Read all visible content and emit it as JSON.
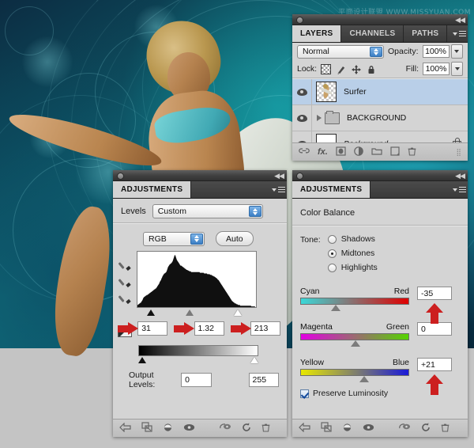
{
  "app": {
    "watermark": "平面设计联盟   WWW.MISSYUAN.COM"
  },
  "layers_panel": {
    "grip_collapse_icon": "collapse-left-icon",
    "tabs": [
      {
        "label": "LAYERS",
        "active": true
      },
      {
        "label": "CHANNELS",
        "active": false
      },
      {
        "label": "PATHS",
        "active": false
      }
    ],
    "menu_icon": "panel-menu-icon",
    "blend_mode": "Normal",
    "opacity_label": "Opacity:",
    "opacity_value": "100%",
    "lock_label": "Lock:",
    "lock_icons": [
      "lock-transparent-icon",
      "lock-image-icon",
      "lock-position-icon",
      "lock-all-icon"
    ],
    "fill_label": "Fill:",
    "fill_value": "100%",
    "layers": [
      {
        "name": "Surfer",
        "visible": true,
        "selected": true,
        "type": "image",
        "style": "normal"
      },
      {
        "name": "BACKGROUND",
        "visible": true,
        "selected": false,
        "type": "group",
        "style": "normal"
      },
      {
        "name": "Background",
        "visible": true,
        "selected": false,
        "type": "locked",
        "style": "italic"
      }
    ],
    "footer_icons": [
      "link-layers-icon",
      "layer-style-fx-icon",
      "layer-mask-icon",
      "adjustment-layer-icon",
      "new-group-icon",
      "new-layer-icon",
      "delete-layer-icon"
    ]
  },
  "levels_panel": {
    "title": "ADJUSTMENTS",
    "menu_icon": "panel-menu-icon",
    "adjustment_name": "Levels",
    "preset": "Custom",
    "channel": "RGB",
    "auto_label": "Auto",
    "dropper_icons": [
      "black-point-dropper-icon",
      "gray-point-dropper-icon",
      "white-point-dropper-icon"
    ],
    "input_black": "31",
    "input_gamma": "1.32",
    "input_white": "213",
    "output_label": "Output Levels:",
    "output_black": "0",
    "output_white": "255",
    "arrow_icon": "red-arrow-right-icon",
    "footer_icons": [
      "return-to-adjustment-list-icon",
      "clip-to-layer-icon",
      "toggle-layer-visibility-icon",
      "preview-eye-icon",
      "view-previous-state-icon",
      "reset-icon",
      "delete-adjustment-icon"
    ],
    "histogram": [
      3,
      3,
      4,
      4,
      5,
      5,
      6,
      6,
      7,
      8,
      9,
      10,
      12,
      13,
      14,
      14,
      15,
      15,
      16,
      16,
      17,
      17,
      17,
      18,
      18,
      19,
      19,
      20,
      20,
      21,
      21,
      22,
      22,
      23,
      23,
      24,
      24,
      25,
      25,
      26,
      26,
      27,
      28,
      29,
      30,
      31,
      32,
      33,
      35,
      36,
      37,
      38,
      40,
      41,
      43,
      44,
      45,
      46,
      47,
      47,
      48,
      48,
      49,
      50,
      52,
      54,
      56,
      57,
      58,
      59,
      60,
      60,
      61,
      61,
      62,
      63,
      64,
      66,
      68,
      70,
      72,
      73,
      72,
      70,
      68,
      66,
      65,
      64,
      63,
      62,
      61,
      60,
      59,
      58,
      58,
      58,
      57,
      57,
      56,
      56,
      55,
      55,
      54,
      54,
      53,
      53,
      52,
      52,
      52,
      51,
      51,
      51,
      50,
      50,
      50,
      50,
      49,
      49,
      49,
      49,
      49,
      49,
      49,
      49,
      49,
      49,
      49,
      49,
      49,
      49,
      49,
      49,
      49,
      49,
      49,
      48,
      48,
      48,
      48,
      48,
      48,
      48,
      48,
      48,
      47,
      47,
      47,
      47,
      47,
      47,
      47,
      46,
      46,
      46,
      46,
      46,
      46,
      45,
      45,
      45,
      45,
      44,
      44,
      44,
      43,
      43,
      43,
      42,
      42,
      41,
      41,
      40,
      40,
      39,
      38,
      38,
      37,
      36,
      35,
      34,
      33,
      32,
      31,
      30,
      29,
      28,
      27,
      26,
      25,
      24,
      23,
      22,
      21,
      20,
      19,
      18,
      17,
      16,
      15,
      14,
      13,
      12,
      11,
      10,
      9,
      8,
      8,
      7,
      7,
      6,
      6,
      5,
      5,
      5,
      4,
      4,
      4,
      3,
      3,
      3,
      3,
      3,
      2,
      2,
      2,
      2,
      2,
      2,
      2,
      2,
      2,
      2,
      2,
      2,
      2,
      2,
      2,
      2,
      2,
      2,
      2,
      2,
      2,
      2,
      2,
      2,
      1,
      1,
      1,
      1,
      1,
      1,
      1,
      1,
      1
    ]
  },
  "color_balance_panel": {
    "title": "ADJUSTMENTS",
    "menu_icon": "panel-menu-icon",
    "adjustment_name": "Color Balance",
    "tone_label": "Tone:",
    "tone_options": [
      {
        "label": "Shadows",
        "selected": false
      },
      {
        "label": "Midtones",
        "selected": true
      },
      {
        "label": "Highlights",
        "selected": false
      }
    ],
    "sliders": [
      {
        "left_label": "Cyan",
        "right_label": "Red",
        "value": "-35",
        "knob_pct": 32,
        "from": "#3ad8d8",
        "to": "#e00000",
        "arrow": true
      },
      {
        "left_label": "Magenta",
        "right_label": "Green",
        "value": "0",
        "knob_pct": 50,
        "from": "#e200e2",
        "to": "#55d400",
        "arrow": false
      },
      {
        "left_label": "Yellow",
        "right_label": "Blue",
        "value": "+21",
        "knob_pct": 58,
        "from": "#e8e800",
        "to": "#1a1ad8",
        "arrow": true
      }
    ],
    "preserve_luminosity_label": "Preserve Luminosity",
    "preserve_luminosity_checked": true,
    "arrow_icon": "red-arrow-up-icon",
    "footer_icons": [
      "return-to-adjustment-list-icon",
      "clip-to-layer-icon",
      "toggle-layer-visibility-icon",
      "preview-eye-icon",
      "view-previous-state-icon",
      "reset-icon",
      "delete-adjustment-icon"
    ]
  },
  "colors": {
    "panel_bg": "#d4d4d4",
    "panel_chrome": "#3a3a3a",
    "selection_blue": "#b9cfe8",
    "red_arrow": "#cc1f1f",
    "desktop_gray": "#c4c4c4"
  }
}
